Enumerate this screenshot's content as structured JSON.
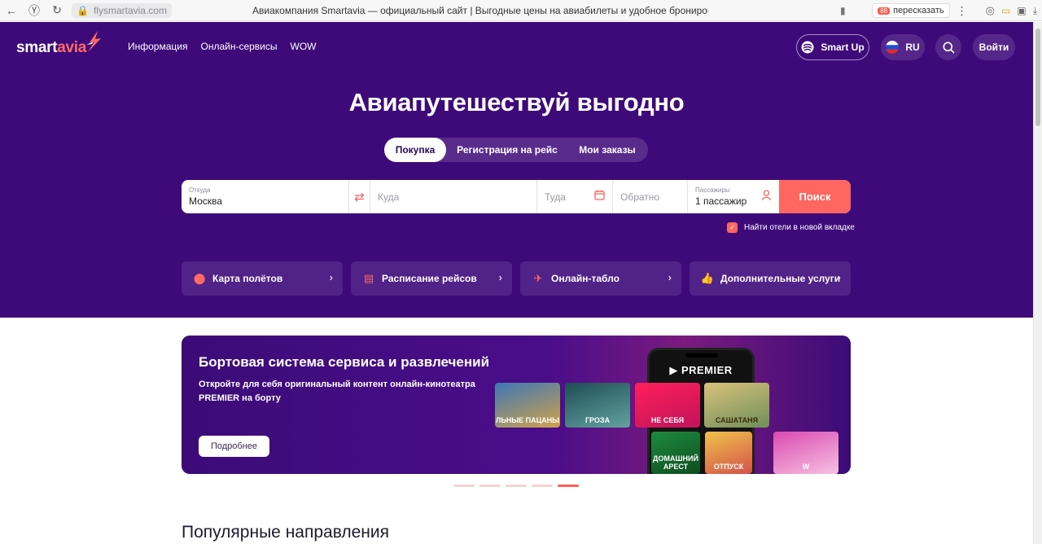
{
  "browser": {
    "url": "flysmartavia.com",
    "title": "Авиакомпания Smartavia — официальный сайт | Выгодные цены на авиабилеты и удобное бронирование",
    "retell_label": "пересказать",
    "retell_badge": "88"
  },
  "header": {
    "logo_main": "smart",
    "logo_accent": "avia",
    "nav": [
      "Информация",
      "Онлайн-сервисы",
      "WOW"
    ],
    "smartup_label": "Smart Up",
    "lang_label": "RU",
    "login_label": "Войти"
  },
  "hero": {
    "title": "Авиапутешествуй выгодно",
    "tabs": [
      "Покупка",
      "Регистрация на рейс",
      "Мои заказы"
    ]
  },
  "search": {
    "from_label": "Откуда",
    "from_value": "Москва",
    "to_placeholder": "Куда",
    "date_placeholder": "Туда",
    "return_placeholder": "Обратно",
    "pax_label": "Пассажиры",
    "pax_value": "1 пассажир",
    "button": "Поиск",
    "hotel_checkbox": "Найти отели в новой вкладке"
  },
  "quick_links": [
    "Карта полётов",
    "Расписание рейсов",
    "Онлайн-табло",
    "Дополнительные услуги"
  ],
  "banner": {
    "title": "Бортовая система сервиса и развлечений",
    "text": "Откройте для себя оригинальный контент онлайн-кинотеатра PREMIER на борту",
    "button": "Подробнее",
    "brand": "▶ PREMIER",
    "posters": [
      "ЛЬНЫЕ ПАЦАНЫ",
      "ГРОЗА",
      "НЕ СЕБЯ",
      "САШАТАНЯ",
      "ДОМАШНИЙ АРЕСТ",
      "ОТПУСК",
      "W"
    ]
  },
  "carousel": {
    "count": 5,
    "active": 4
  },
  "popular": {
    "title": "Популярные направления"
  },
  "colors": {
    "hero_bg": "#3e0a7a",
    "accent": "#ff6660"
  }
}
